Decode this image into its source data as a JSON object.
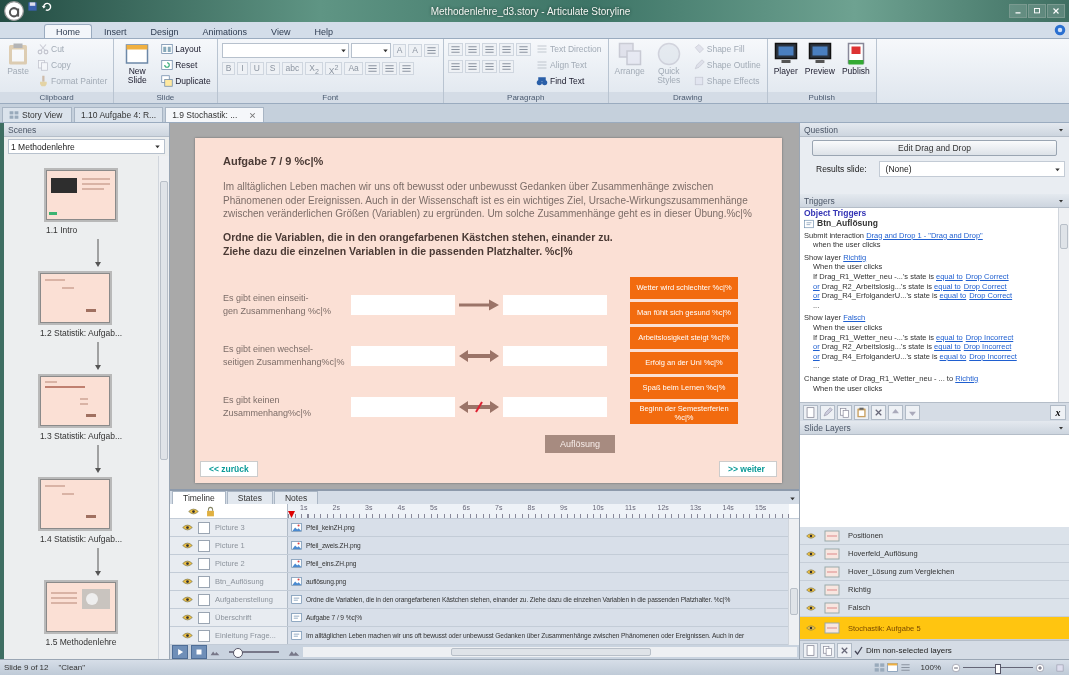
{
  "window": {
    "title": "Methodenlehre_d3.story - Articulate Storyline"
  },
  "ribbon": {
    "tabs": [
      {
        "label": "Home",
        "selected": true
      },
      {
        "label": "Insert",
        "selected": false
      },
      {
        "label": "Design",
        "selected": false
      },
      {
        "label": "Animations",
        "selected": false
      },
      {
        "label": "View",
        "selected": false
      },
      {
        "label": "Help",
        "selected": false
      }
    ],
    "groups": [
      {
        "label": "Clipboard",
        "items": [
          {
            "kind": "large",
            "label": "Paste",
            "disabled": true
          },
          {
            "kind": "small",
            "label": "Cut",
            "disabled": true
          },
          {
            "kind": "small",
            "label": "Copy",
            "disabled": true
          },
          {
            "kind": "small",
            "label": "Format Painter",
            "disabled": true
          }
        ]
      },
      {
        "label": "Slide",
        "items": [
          {
            "kind": "large",
            "label": "New Slide",
            "disabled": false
          },
          {
            "kind": "small",
            "label": "Layout",
            "disabled": false
          },
          {
            "kind": "small",
            "label": "Reset",
            "disabled": false
          },
          {
            "kind": "small",
            "label": "Duplicate",
            "disabled": false
          }
        ]
      },
      {
        "label": "Font",
        "rows": [
          [
            {
              "kind": "combo"
            },
            {
              "kind": "combo"
            },
            {
              "kind": "glyph",
              "text": "A"
            },
            {
              "kind": "glyph",
              "text": "A"
            },
            {
              "kind": "icon"
            }
          ],
          [
            {
              "kind": "glyph",
              "text": "B"
            },
            {
              "kind": "glyph",
              "text": "I"
            },
            {
              "kind": "glyph",
              "text": "U"
            },
            {
              "kind": "glyph",
              "text": "S"
            },
            {
              "kind": "glyph",
              "text": "abc"
            },
            {
              "kind": "glyph",
              "text": "X$_{2}$"
            },
            {
              "kind": "glyph",
              "text": "X$^{2}$"
            },
            {
              "kind": "glyph",
              "text": "Aa"
            },
            {
              "kind": "icon"
            },
            {
              "kind": "icon"
            },
            {
              "kind": "icon"
            }
          ]
        ]
      },
      {
        "label": "Paragraph",
        "rows": [
          [
            {
              "kind": "icon"
            },
            {
              "kind": "icon"
            },
            {
              "kind": "icon"
            },
            {
              "kind": "icon"
            },
            {
              "kind": "icon"
            }
          ],
          [
            {
              "kind": "icon"
            },
            {
              "kind": "icon"
            },
            {
              "kind": "icon"
            },
            {
              "kind": "icon"
            }
          ]
        ],
        "items": [
          {
            "kind": "small",
            "label": "Text Direction",
            "disabled": true
          },
          {
            "kind": "small",
            "label": "Align Text",
            "disabled": true
          },
          {
            "kind": "small",
            "label": "Find Text",
            "disabled": false
          }
        ]
      },
      {
        "label": "Drawing",
        "items": [
          {
            "kind": "large",
            "label": "Arrange",
            "disabled": true
          },
          {
            "kind": "large",
            "label": "Quick Styles",
            "disabled": true
          },
          {
            "kind": "small",
            "label": "Shape Fill",
            "disabled": true
          },
          {
            "kind": "small",
            "label": "Shape Outline",
            "disabled": true
          },
          {
            "kind": "small",
            "label": "Shape Effects",
            "disabled": true
          }
        ]
      },
      {
        "label": "Publish",
        "items": [
          {
            "kind": "large",
            "label": "Player",
            "disabled": false
          },
          {
            "kind": "large",
            "label": "Preview",
            "disabled": false
          },
          {
            "kind": "large",
            "label": "Publish",
            "disabled": false
          }
        ]
      }
    ]
  },
  "document_tabs": [
    {
      "label": "Story View",
      "selected": false
    },
    {
      "label": "1.10 Aufgabe 4: R...",
      "selected": false
    },
    {
      "label": "1.9 Stochastik: ...",
      "selected": true
    }
  ],
  "scenes": {
    "title": "Scenes",
    "scene": "1 Methodenlehre",
    "slides": [
      {
        "label": "1.1 Intro",
        "kind": "intro"
      },
      {
        "label": "1.2 Statistik: Aufgab...",
        "kind": "task"
      },
      {
        "label": "1.3 Statistik: Aufgab...",
        "kind": "list"
      },
      {
        "label": "1.4 Statistik: Aufgab...",
        "kind": "task"
      },
      {
        "label": "1.5 Methodenlehre",
        "kind": "photo"
      }
    ]
  },
  "slide": {
    "title": "Aufgabe 7 / 9 %c|%",
    "intro": "Im alltäglichen Leben machen wir uns oft bewusst oder unbewusst Gedanken über Zusammenhänge zwischen Phänomenen oder Ereignissen. Auch in der Wissenschaft ist es ein wichtiges Ziel, Ursache-Wirkungszusammenhänge zwischen veränderlichen Größen (Variablen) zu ergründen. Um solche Zusammenhänge geht es in dieser Übung.%c|%",
    "instruction": "Ordne die Variablen, die in den orangefarbenen Kästchen stehen, einander zu. Ziehe dazu die einzelnen Variablen in die passenden Platzhalter. %c|%",
    "relations": [
      {
        "label": "Es gibt einen einseiti-\ngen Zusammenhang %c|%",
        "kind": "one-way"
      },
      {
        "label": "Es gibt einen wechsel-\nseitigen Zusammenhang%c|%",
        "kind": "two-way"
      },
      {
        "label": "Es gibt keinen\nZusammenhang%c|%",
        "kind": "none"
      }
    ],
    "drag_items": [
      "Wetter wird schlechter %c|%",
      "Man fühlt sich gesund %c|%",
      "Arbeitslosigkeit steigt %c|%",
      "Erfolg an der Uni %c|%",
      "Spaß beim Lernen %c|%",
      "Beginn der Semesterferien %c|%"
    ],
    "solution_button": "Auflösung",
    "back_button": "<< zurück",
    "next_button": ">> weiter"
  },
  "timeline": {
    "tabs": [
      {
        "label": "Timeline",
        "selected": true
      },
      {
        "label": "States",
        "selected": false
      },
      {
        "label": "Notes",
        "selected": false
      }
    ],
    "ruler": [
      "1s",
      "2s",
      "3s",
      "4s",
      "5s",
      "6s",
      "7s",
      "8s",
      "9s",
      "10s",
      "11s",
      "12s",
      "13s",
      "14s",
      "15s"
    ],
    "rows": [
      {
        "name": "Picture 3",
        "object": "Pfeil_keinZH.png",
        "kind": "picture",
        "locked": false
      },
      {
        "name": "Picture 1",
        "object": "Pfeil_zweis.ZH.png",
        "kind": "picture",
        "locked": false
      },
      {
        "name": "Picture 2",
        "object": "Pfeil_eins.ZH.png",
        "kind": "picture",
        "locked": false
      },
      {
        "name": "Btn_Auflösung",
        "object": "auflösung.png",
        "kind": "picture",
        "locked": false
      },
      {
        "name": "Aufgabenstellung",
        "object": "Ordne die Variablen, die in den orangefarbenen Kästchen stehen, einander zu. Ziehe dazu die einzelnen Variablen in die passenden Platzhalter. %c|%",
        "kind": "text",
        "locked": false
      },
      {
        "name": "Überschrift",
        "object": "Aufgabe 7 / 9 %c|%",
        "kind": "text",
        "locked": false
      },
      {
        "name": "Einleitung Frage...",
        "object": "Im alltäglichen Leben machen wir uns oft bewusst oder unbewusst Gedanken über Zusammenhänge zwischen Phänomenen oder Ereignissen. Auch in der",
        "kind": "text",
        "locked": false
      }
    ],
    "zoom": {
      "level": 0.15
    }
  },
  "question": {
    "title": "Question",
    "edit_button": "Edit Drag and Drop",
    "results_label": "Results slide:",
    "results_value": "(None)"
  },
  "triggers": {
    "title": "Triggers",
    "heading": "Object Triggers",
    "object": "Btn_Auflösung",
    "variables_button": "x",
    "lines": [
      {
        "indent": false,
        "parts": [
          {
            "text": "Submit interaction ",
            "link": false
          },
          {
            "text": "Drag and Drop 1 - \"Drag and Drop\"",
            "link": true
          }
        ]
      },
      {
        "indent": true,
        "parts": [
          {
            "text": "when the user clicks",
            "link": false
          }
        ]
      },
      {
        "indent": false,
        "parts": [
          {
            "text": "Show layer ",
            "link": false
          },
          {
            "text": "Richtig",
            "link": true
          }
        ]
      },
      {
        "indent": true,
        "parts": [
          {
            "text": "When the user clicks",
            "link": false
          }
        ]
      },
      {
        "indent": true,
        "parts": [
          {
            "text": "If Drag_R1_Wetter_neu -...'s state is ",
            "link": false
          },
          {
            "text": "equal to",
            "link": true
          },
          {
            "text": "Drop Correct",
            "link": true
          }
        ]
      },
      {
        "indent": true,
        "parts": [
          {
            "text": "or",
            "link": true
          },
          {
            "text": " Drag_R2_Arbeitslosig...'s state is ",
            "link": false
          },
          {
            "text": "equal to",
            "link": true
          },
          {
            "text": "Drop Correct",
            "link": true
          }
        ]
      },
      {
        "indent": true,
        "parts": [
          {
            "text": "or",
            "link": true
          },
          {
            "text": " Drag_R4_ErfolganderU...'s state is ",
            "link": false
          },
          {
            "text": "equal to",
            "link": true
          },
          {
            "text": "Drop Correct",
            "link": true
          }
        ]
      },
      {
        "indent": true,
        "parts": [
          {
            "text": "...",
            "link": false
          }
        ]
      },
      {
        "indent": false,
        "parts": [
          {
            "text": "Show layer ",
            "link": false
          },
          {
            "text": "Falsch",
            "link": true
          }
        ]
      },
      {
        "indent": true,
        "parts": [
          {
            "text": "When the user clicks",
            "link": false
          }
        ]
      },
      {
        "indent": true,
        "parts": [
          {
            "text": "If Drag_R1_Wetter_neu -...'s state is ",
            "link": false
          },
          {
            "text": "equal to",
            "link": true
          },
          {
            "text": "Drop Incorrect",
            "link": true
          }
        ]
      },
      {
        "indent": true,
        "parts": [
          {
            "text": "or",
            "link": true
          },
          {
            "text": " Drag_R2_Arbeitslosig...'s state is ",
            "link": false
          },
          {
            "text": "equal to",
            "link": true
          },
          {
            "text": "Drop Incorrect",
            "link": true
          }
        ]
      },
      {
        "indent": true,
        "parts": [
          {
            "text": "or",
            "link": true
          },
          {
            "text": " Drag_R4_ErfolganderU...'s state is ",
            "link": false
          },
          {
            "text": "equal to",
            "link": true
          },
          {
            "text": "Drop Incorrect",
            "link": true
          }
        ]
      },
      {
        "indent": true,
        "parts": [
          {
            "text": "...",
            "link": false
          }
        ]
      },
      {
        "indent": false,
        "parts": [
          {
            "text": "Change state of Drag_R1_Wetter_neu - ... to ",
            "link": false
          },
          {
            "text": "Richtig",
            "link": true
          }
        ]
      },
      {
        "indent": true,
        "parts": [
          {
            "text": "When the user clicks",
            "link": false
          }
        ]
      }
    ]
  },
  "layers": {
    "title": "Slide Layers",
    "items": [
      {
        "name": "Positionen",
        "selected": false
      },
      {
        "name": "Hoverfeld_Auflösung",
        "selected": false
      },
      {
        "name": "Hover_Lösung zum Vergleichen",
        "selected": false
      },
      {
        "name": "Richtig",
        "selected": false
      },
      {
        "name": "Falsch",
        "selected": false
      },
      {
        "name": "Stochastik: Aufgabe 5",
        "selected": true
      }
    ],
    "dim": {
      "label": "Dim non-selected layers",
      "checked": true
    }
  },
  "status_bar": {
    "slide": "Slide 9 of 12",
    "theme": "\"Clean\"",
    "zoom": "100%",
    "zoom_slider": {
      "level": 0.5
    }
  }
}
